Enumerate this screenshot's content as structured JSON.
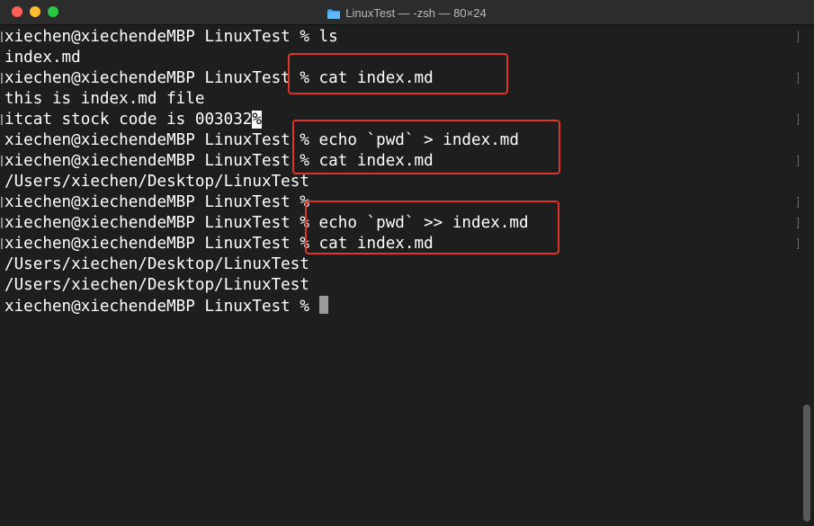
{
  "window": {
    "title": "LinuxTest — -zsh — 80×24",
    "folder_icon": "folder-icon",
    "controls": [
      "close",
      "minimize",
      "zoom"
    ]
  },
  "terminal": {
    "lines": [
      "xiechen@xiechendeMBP LinuxTest % ls",
      "index.md",
      "xiechen@xiechendeMBP LinuxTest % cat index.md",
      "this is index.md file",
      "itcat stock code is 003032",
      "xiechen@xiechendeMBP LinuxTest % echo `pwd` > index.md",
      "xiechen@xiechendeMBP LinuxTest % cat index.md",
      "/Users/xiechen/Desktop/LinuxTest",
      "xiechen@xiechendeMBP LinuxTest %",
      "xiechen@xiechendeMBP LinuxTest % echo `pwd` >> index.md",
      "xiechen@xiechendeMBP LinuxTest % cat index.md",
      "/Users/xiechen/Desktop/LinuxTest",
      "/Users/xiechen/Desktop/LinuxTest",
      "xiechen@xiechendeMBP LinuxTest % "
    ],
    "no_newline_marker": "%"
  },
  "colors": {
    "background": "#1e1e1e",
    "text": "#ffffff",
    "annotation_box": "#e0342a"
  }
}
